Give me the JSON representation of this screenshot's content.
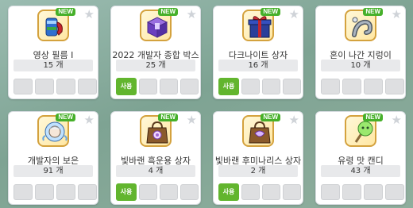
{
  "items": [
    {
      "name": "영상 필름 I",
      "count": "15 개",
      "badge": "NEW",
      "icon": "film-can-icon",
      "use_label": ""
    },
    {
      "name": "2022 개발자 종합 박스",
      "count": "25 개",
      "badge": "NEW",
      "icon": "purple-box-icon",
      "use_label": "사용"
    },
    {
      "name": "다크나이트 상자",
      "count": "16 개",
      "badge": "NEW",
      "icon": "gift-box-icon",
      "use_label": "사용"
    },
    {
      "name": "혼이 나간 지렁이",
      "count": "10 개",
      "badge": "NEW",
      "icon": "worm-icon",
      "use_label": ""
    },
    {
      "name": "개발자의 보은",
      "count": "91 개",
      "badge": "NEW",
      "icon": "angel-character-icon",
      "use_label": ""
    },
    {
      "name": "빛바랜 흑운용 상자",
      "count": "4 개",
      "badge": "NEW",
      "icon": "shopping-bag-icon",
      "use_label": "사용"
    },
    {
      "name": "빛바랜 후미나리스 상자",
      "count": "2 개",
      "badge": "NEW",
      "icon": "shopping-bag-icon",
      "use_label": "사용"
    },
    {
      "name": "유령 맛 캔디",
      "count": "43 개",
      "badge": "NEW",
      "icon": "candy-icon",
      "use_label": ""
    }
  ]
}
